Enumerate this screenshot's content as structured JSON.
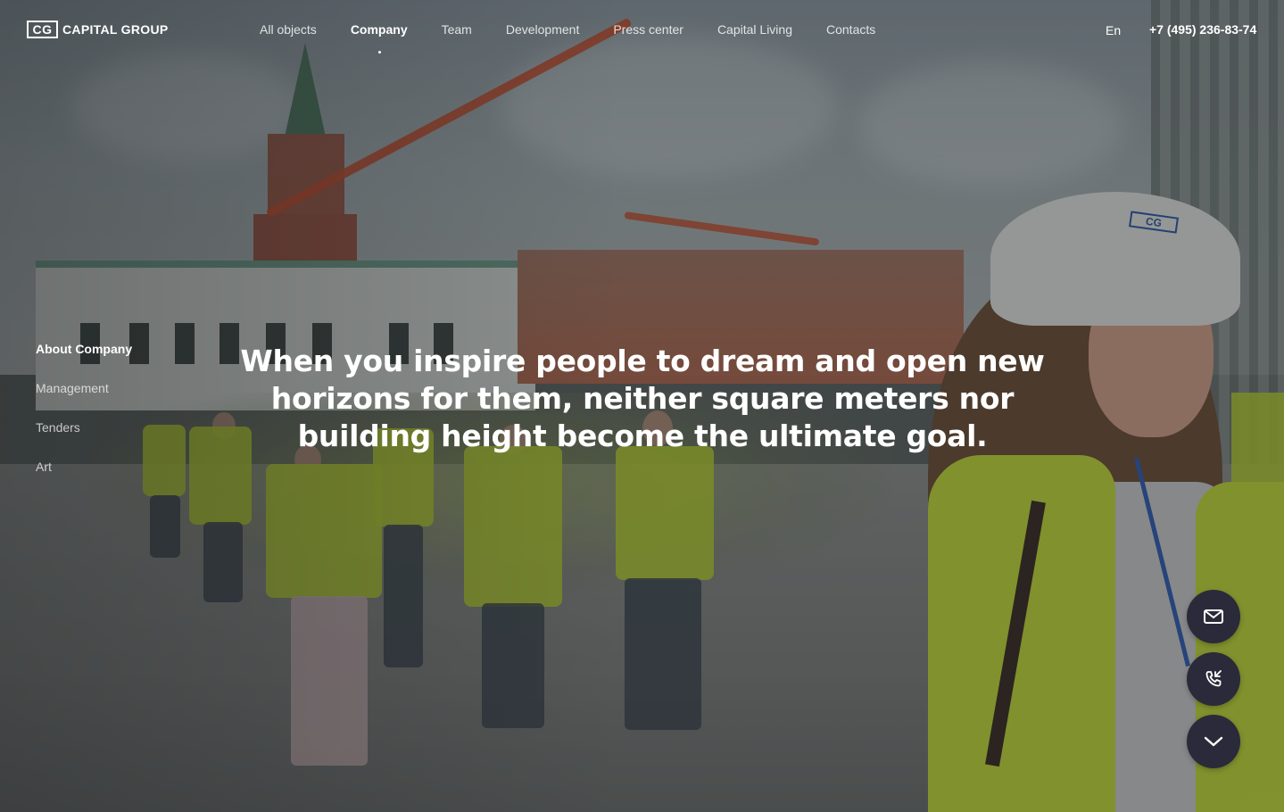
{
  "brand": {
    "mark": "CG",
    "name": "CAPITAL GROUP"
  },
  "nav": [
    {
      "label": "All objects"
    },
    {
      "label": "Company",
      "active": true
    },
    {
      "label": "Team"
    },
    {
      "label": "Development"
    },
    {
      "label": "Press center"
    },
    {
      "label": "Capital Living"
    },
    {
      "label": "Contacts"
    }
  ],
  "language": "En",
  "phone": "+7 (495) 236-83-74",
  "side_menu": [
    {
      "label": "About Company",
      "active": true
    },
    {
      "label": "Management"
    },
    {
      "label": "Tenders"
    },
    {
      "label": "Art"
    }
  ],
  "headline": "When you inspire people to dream and open new horizons for them, neither square meters nor building height become the ultimate goal.",
  "helmet_logo": "CG",
  "actions": [
    {
      "icon": "mail-icon"
    },
    {
      "icon": "phone-icon"
    },
    {
      "icon": "chevron-down-icon"
    }
  ],
  "colors": {
    "fab_background": "#2b2a3a",
    "vest": "#c6e038",
    "text": "#ffffff"
  }
}
